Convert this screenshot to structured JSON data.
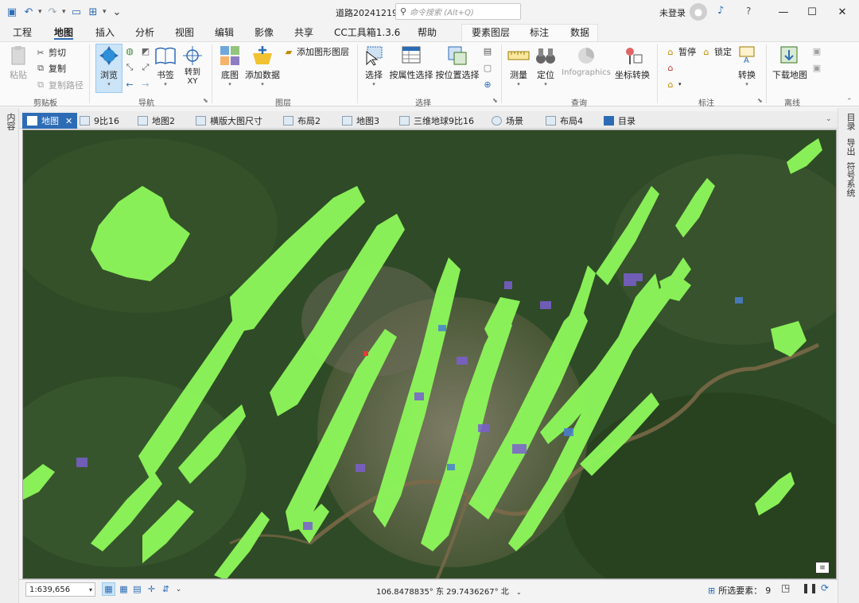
{
  "window": {
    "title": "道路20241219",
    "search_placeholder": "命令搜索 (Alt+Q)",
    "user": "未登录"
  },
  "ribbon_tabs": [
    "工程",
    "地图",
    "插入",
    "分析",
    "视图",
    "编辑",
    "影像",
    "共享",
    "CC工具箱1.3.6",
    "帮助",
    "要素图层",
    "标注",
    "数据"
  ],
  "active_tab": "地图",
  "ribbon": {
    "clipboard": {
      "label": "剪贴板",
      "paste": "粘贴",
      "cut": "剪切",
      "copy": "复制",
      "copy_path": "复制路径"
    },
    "navigate": {
      "label": "导航",
      "explore": "浏览",
      "bookmarks": "书签",
      "goto_xy": "转到XY"
    },
    "layer": {
      "label": "图层",
      "basemap": "底图",
      "add_data": "添加数据",
      "add_graphics_layer": "添加图形图层"
    },
    "selection": {
      "label": "选择",
      "select": "选择",
      "select_by_attributes": "按属性选择",
      "select_by_location": "按位置选择"
    },
    "inquiry": {
      "label": "查询",
      "measure": "测量",
      "locate": "定位",
      "infographics": "Infographics",
      "convert_coordinates": "坐标转换"
    },
    "labeling": {
      "label": "标注",
      "pause": "暂停",
      "lock": "锁定",
      "convert": "转换"
    },
    "offline": {
      "label": "离线",
      "download_map": "下载地图"
    }
  },
  "side_panes": {
    "left": "内容",
    "right": [
      "目录",
      "导出",
      "符号系统"
    ]
  },
  "doc_tabs": [
    "地图",
    "9比16",
    "地图2",
    "横版大图尺寸",
    "布局2",
    "地图3",
    "三维地球9比16",
    "场景",
    "布局4",
    "目录"
  ],
  "active_doc_tab": "地图",
  "status": {
    "scale": "1:639,656",
    "coordinates": "106.8478835° 东  29.7436267° 北",
    "selected_features_label": "所选要素：",
    "selected_features_count": "9"
  },
  "colors": {
    "accent": "#2d6cb5",
    "highlight_layer": "#8cf55a",
    "urban_layer": "#7a5fcf"
  }
}
